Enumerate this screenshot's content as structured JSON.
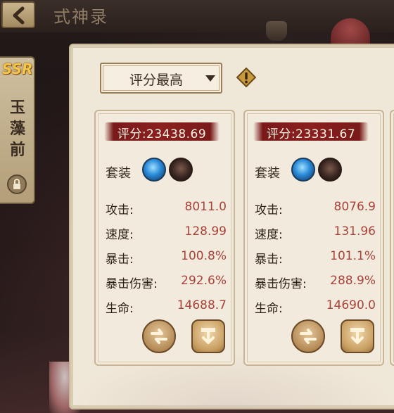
{
  "header": {
    "title": "式神录"
  },
  "shikigami": {
    "rarity": "SSR",
    "name": "玉藻前"
  },
  "sort": {
    "selected": "评分最高"
  },
  "cards": [
    {
      "score": "评分:23438.69",
      "set_label": "套装",
      "stats": [
        {
          "name": "攻击:",
          "value": "8011.0"
        },
        {
          "name": "速度:",
          "value": "128.99"
        },
        {
          "name": "暴击:",
          "value": "100.8%"
        },
        {
          "name": "暴击伤害:",
          "value": "292.6%"
        },
        {
          "name": "生命:",
          "value": "14688.7"
        }
      ]
    },
    {
      "score": "评分:23331.67",
      "set_label": "套装",
      "stats": [
        {
          "name": "攻击:",
          "value": "8076.9"
        },
        {
          "name": "速度:",
          "value": "131.96"
        },
        {
          "name": "暴击:",
          "value": "101.1%"
        },
        {
          "name": "暴击伤害:",
          "value": "288.9%"
        },
        {
          "name": "生命:",
          "value": "14690.0"
        }
      ]
    }
  ],
  "colors": {
    "stat_value": "#a8423a",
    "score_banner": "#8a1f1f",
    "panel": "#efe7d7"
  }
}
